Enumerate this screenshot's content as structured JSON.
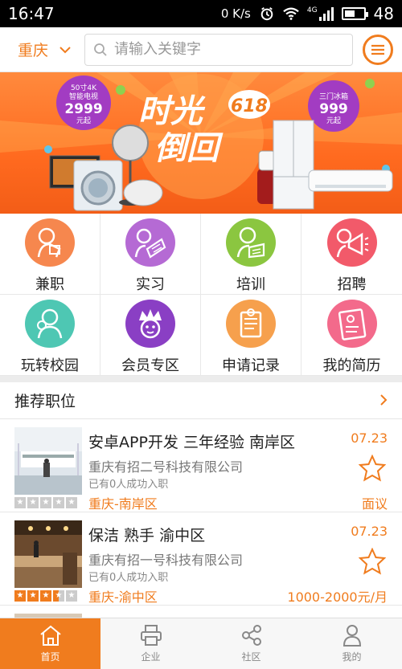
{
  "status": {
    "time": "16:47",
    "net_speed": "0 K/s",
    "network": "4G",
    "battery": "48"
  },
  "header": {
    "city": "重庆",
    "search_placeholder": "请输入关键字"
  },
  "banner": {
    "left_badge": [
      "50寸4K",
      "智能电视",
      "2999",
      "元起"
    ],
    "headline_top": "时光",
    "headline_bottom": "倒回",
    "promo": "618",
    "right_badge": [
      "三门冰箱",
      "999",
      "元起"
    ]
  },
  "grid": [
    {
      "label": "兼职",
      "color": "#f6874e"
    },
    {
      "label": "实习",
      "color": "#b56ad4"
    },
    {
      "label": "培训",
      "color": "#8bc640"
    },
    {
      "label": "招聘",
      "color": "#f25a6a"
    },
    {
      "label": "玩转校园",
      "color": "#4ec7b3"
    },
    {
      "label": "会员专区",
      "color": "#8a3fc4"
    },
    {
      "label": "申请记录",
      "color": "#f6a04d"
    },
    {
      "label": "我的简历",
      "color": "#f36a8b"
    }
  ],
  "recommend": {
    "title": "推荐职位",
    "arrow": "›"
  },
  "jobs": [
    {
      "title": "安卓APP开发 三年经验 南岸区",
      "company": "重庆有招二号科技有限公司",
      "count": "已有0人成功入职",
      "location": "重庆-南岸区",
      "date": "07.23",
      "salary": "面议",
      "rating": 0
    },
    {
      "title": "保洁 熟手 渝中区",
      "company": "重庆有招一号科技有限公司",
      "count": "已有0人成功入职",
      "location": "重庆-渝中区",
      "date": "07.23",
      "salary": "1000-2000元/月",
      "rating": 3.5
    }
  ],
  "tabs": [
    {
      "label": "首页",
      "icon": "home-icon",
      "active": true
    },
    {
      "label": "企业",
      "icon": "printer-icon",
      "active": false
    },
    {
      "label": "社区",
      "icon": "share-icon",
      "active": false
    },
    {
      "label": "我的",
      "icon": "user-icon",
      "active": false
    }
  ]
}
